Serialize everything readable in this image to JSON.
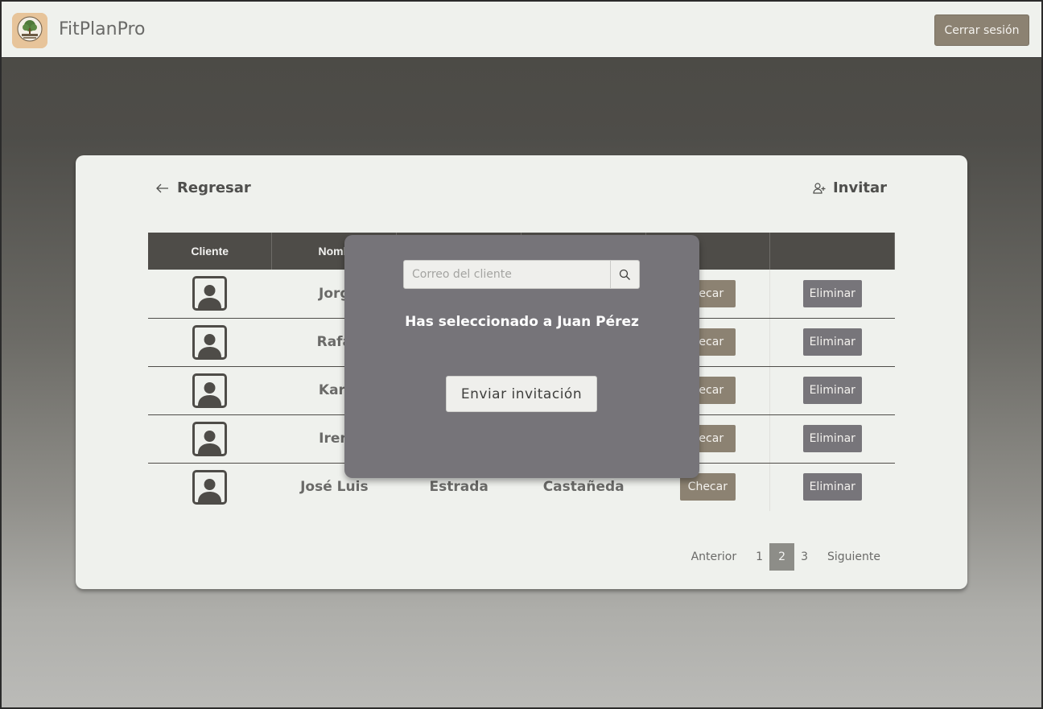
{
  "header": {
    "brand": "FitPlanPro",
    "logout_label": "Cerrar sesión"
  },
  "card": {
    "back_label": "Regresar",
    "invite_label": "Invitar"
  },
  "table": {
    "columns": [
      "Cliente",
      "Nomb"
    ],
    "rows": [
      {
        "name": "Jorg",
        "last1": "",
        "last2": "",
        "check": "hecar",
        "delete": "Eliminar"
      },
      {
        "name": "Rafa",
        "last1": "",
        "last2": "",
        "check": "hecar",
        "delete": "Eliminar"
      },
      {
        "name": "Karl",
        "last1": "",
        "last2": "",
        "check": "hecar",
        "delete": "Eliminar"
      },
      {
        "name": "Iren",
        "last1": "",
        "last2": "",
        "check": "hecar",
        "delete": "Eliminar"
      },
      {
        "name": "José Luis",
        "last1": "Estrada",
        "last2": "Castañeda",
        "check": "Checar",
        "delete": "Eliminar"
      }
    ]
  },
  "pagination": {
    "prev": "Anterior",
    "pages": [
      "1",
      "2",
      "3"
    ],
    "current": "2",
    "next": "Siguiente"
  },
  "modal": {
    "search_placeholder": "Correo del cliente",
    "selected_text": "Has seleccionado a Juan Pérez",
    "send_label": "Enviar invitación"
  },
  "colors": {
    "accent": "#8c8272",
    "delete": "#77757a",
    "header_dark": "#4e4c48",
    "modal_bg": "#767479"
  }
}
